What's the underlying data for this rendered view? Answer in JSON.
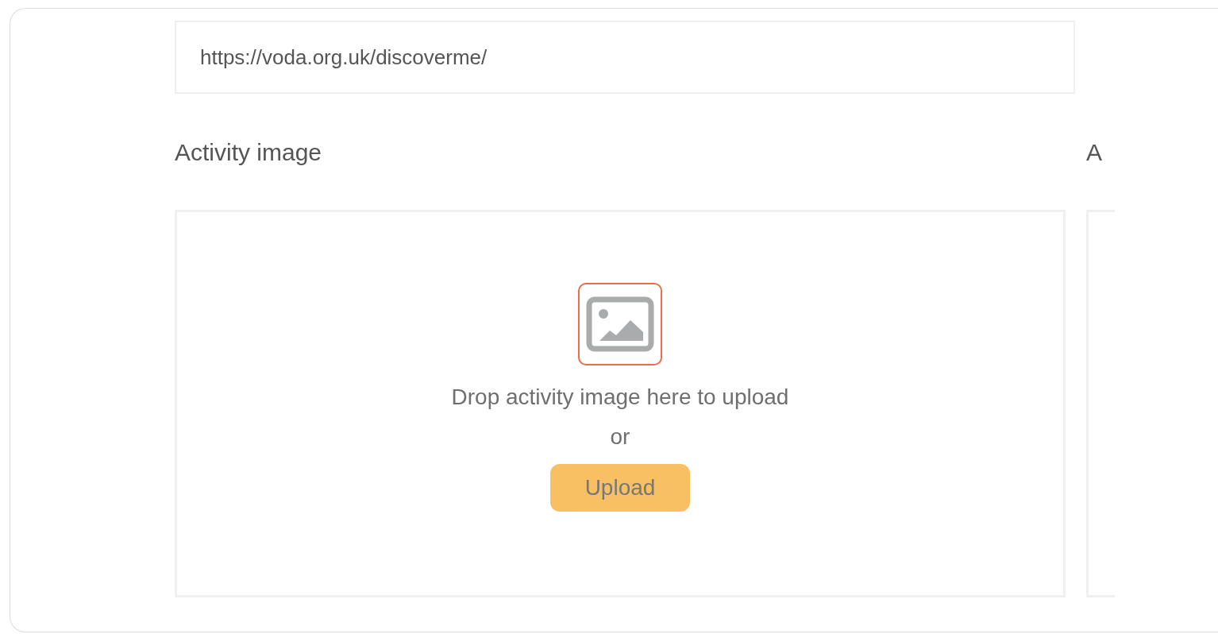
{
  "website_field": {
    "value": "https://voda.org.uk/discoverme/"
  },
  "image_panels": [
    {
      "label": "Activity image",
      "icon_highlighted": true,
      "prompt": "Drop activity image here to upload",
      "separator": "or",
      "button": "Upload"
    },
    {
      "label": "A"
    }
  ]
}
